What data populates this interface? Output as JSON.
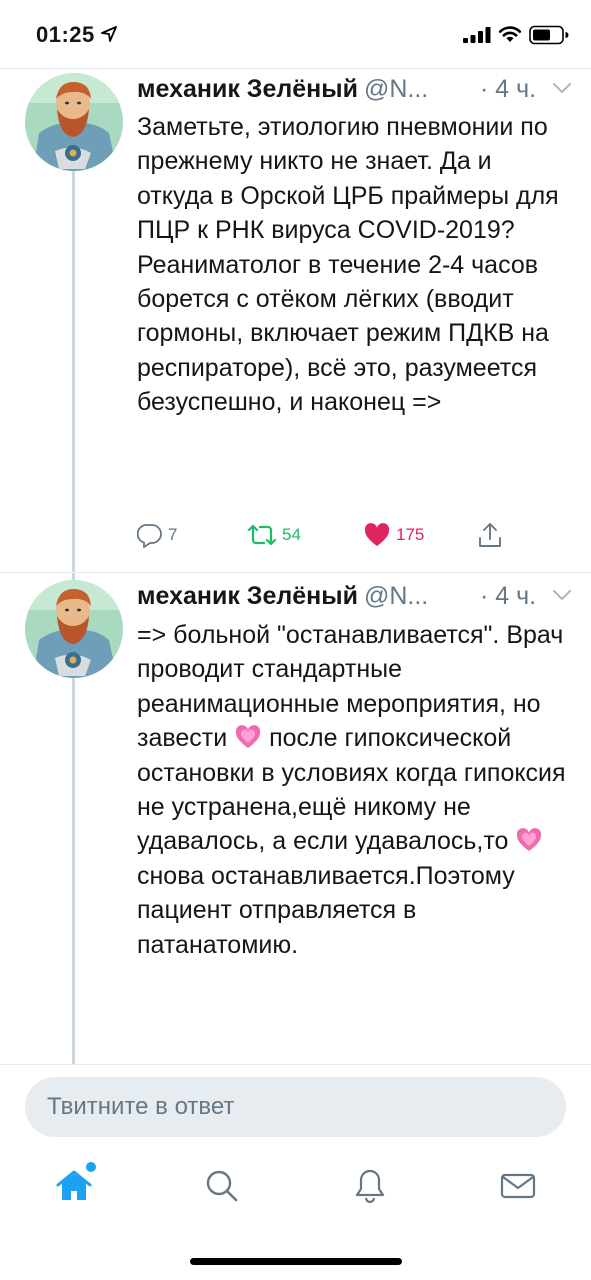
{
  "status_bar": {
    "time": "01:25"
  },
  "tweets": [
    {
      "author": "механик Зелёный",
      "handle": "@N...",
      "time": "· 4 ч.",
      "text": "Заметьте, этиологию пневмонии по прежнему никто не знает. Да и откуда в Орской ЦРБ праймеры для ПЦР к РНК вируса COVID-2019? Реаниматолог в течение 2-4 часов борется с отёком лёгких (вводит гормоны, включает режим ПДКВ на респираторе), всё это, разумеется безуспешно, и наконец =>",
      "replies": "7",
      "retweets": "54",
      "likes": "175"
    },
    {
      "author": "механик Зелёный",
      "handle": "@N...",
      "time": "· 4 ч.",
      "text_part1": "=> больной \"останавливается\". Врач проводит стандартные реанимационные мероприятия, но завести ",
      "text_part2": " после гипоксической остановки в условиях когда гипоксия не устранена,ещё никому не удавалось, а если удавалось,то ",
      "text_part3": " снова останавливается.Поэтому пациент отправляется в патанатомию."
    }
  ],
  "reply_box": {
    "placeholder": "Твитните в ответ"
  },
  "icons": {
    "emoji": "growing-heart",
    "tabs": [
      "home-icon",
      "search-icon",
      "notifications-icon",
      "messages-icon"
    ]
  },
  "colors": {
    "accent": "#1da1f2",
    "text": "#14171a",
    "secondary": "#657786",
    "retweet": "#17bf63",
    "like": "#e0245e",
    "separator": "#e6ecf0"
  }
}
